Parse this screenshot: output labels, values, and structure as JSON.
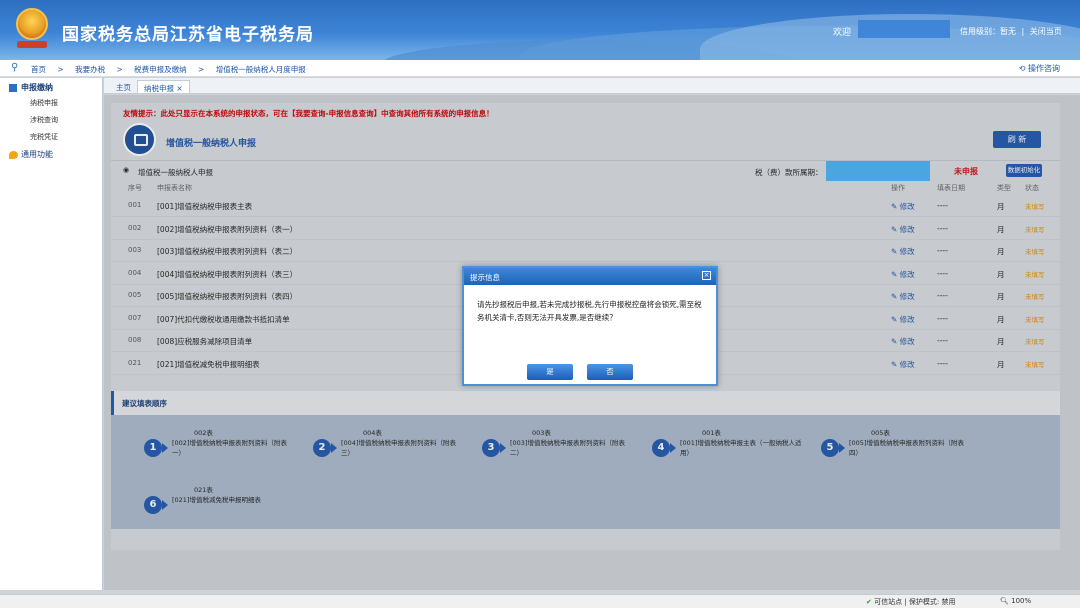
{
  "header": {
    "title": "国家税务总局江苏省电子税务局",
    "welcome": "欢迎",
    "credit_level": "信用级别：暂无",
    "close_page": "关闭当页"
  },
  "breadcrumb": {
    "items": [
      "首页",
      ">",
      "我要办税",
      ">",
      "税费申报及缴纳",
      ">",
      "增值税一般纳税人月度申报"
    ],
    "help": "操作咨询"
  },
  "sidebar": {
    "group1": "申报缴纳",
    "items": [
      "纳税申报",
      "涉税查询",
      "完税凭证"
    ],
    "group2": "通用功能"
  },
  "tabs": [
    "主页",
    "纳税申报 ×"
  ],
  "content": {
    "notice": "友情提示：此处只显示在本系统的申报状态，可在【我要查询-申报信息查询】中查询其他所有系统的申报信息！",
    "app_title": "增值税一般纳税人申报",
    "refresh": "刷 新",
    "sub_label": "增值税一般纳税人申报",
    "period_label": "税（费）款所属期：",
    "undeclared": "未申报",
    "init_btn": "数据初始化",
    "headers": {
      "no": "序号",
      "name": "申报表名称",
      "op": "操作",
      "date": "填表日期",
      "type": "类型",
      "status": "状态"
    },
    "rows": [
      {
        "no": "001",
        "name": "[001]增值税纳税申报表主表",
        "op": "修改",
        "date": "----",
        "type": "月",
        "status": "未填写"
      },
      {
        "no": "002",
        "name": "[002]增值税纳税申报表附列资料（表一）",
        "op": "修改",
        "date": "----",
        "type": "月",
        "status": "未填写"
      },
      {
        "no": "003",
        "name": "[003]增值税纳税申报表附列资料（表二）",
        "op": "修改",
        "date": "----",
        "type": "月",
        "status": "未填写"
      },
      {
        "no": "004",
        "name": "[004]增值税纳税申报表附列资料（表三）",
        "op": "修改",
        "date": "----",
        "type": "月",
        "status": "未填写"
      },
      {
        "no": "005",
        "name": "[005]增值税纳税申报表附列资料（表四）",
        "op": "修改",
        "date": "----",
        "type": "月",
        "status": "未填写"
      },
      {
        "no": "007",
        "name": "[007]代扣代缴税收通用缴款书抵扣清单",
        "op": "修改",
        "date": "----",
        "type": "月",
        "status": "未填写"
      },
      {
        "no": "008",
        "name": "[008]应税服务减除项目清单",
        "op": "修改",
        "date": "----",
        "type": "月",
        "status": "未填写"
      },
      {
        "no": "021",
        "name": "[021]增值税减免税申报明细表",
        "op": "修改",
        "date": "----",
        "type": "月",
        "status": "未填写"
      }
    ],
    "order_title": "建议填表顺序",
    "steps": [
      {
        "num": "1",
        "code": "002表",
        "desc": "[002]增值税纳税申报表附列资料（附表一）"
      },
      {
        "num": "2",
        "code": "004表",
        "desc": "[004]增值税纳税申报表附列资料（附表三）"
      },
      {
        "num": "3",
        "code": "003表",
        "desc": "[003]增值税纳税申报表附列资料（附表二）"
      },
      {
        "num": "4",
        "code": "001表",
        "desc": "[001]增值税纳税申报主表（一般纳税人适用）"
      },
      {
        "num": "5",
        "code": "005表",
        "desc": "[005]增值税纳税申报表附列资料（附表四）"
      },
      {
        "num": "6",
        "code": "021表",
        "desc": "[021]增值税减免税申报明细表"
      }
    ]
  },
  "modal": {
    "title": "提示信息",
    "message": "请先抄报税后申报,若未完成抄报税,先行申报税控盘将会锁死,需至税务机关清卡,否则无法开具发票,是否继续？",
    "yes": "是",
    "no": "否"
  },
  "statusbar": {
    "zone": "可信站点 | 保护模式: 禁用",
    "zoom": "100%"
  }
}
